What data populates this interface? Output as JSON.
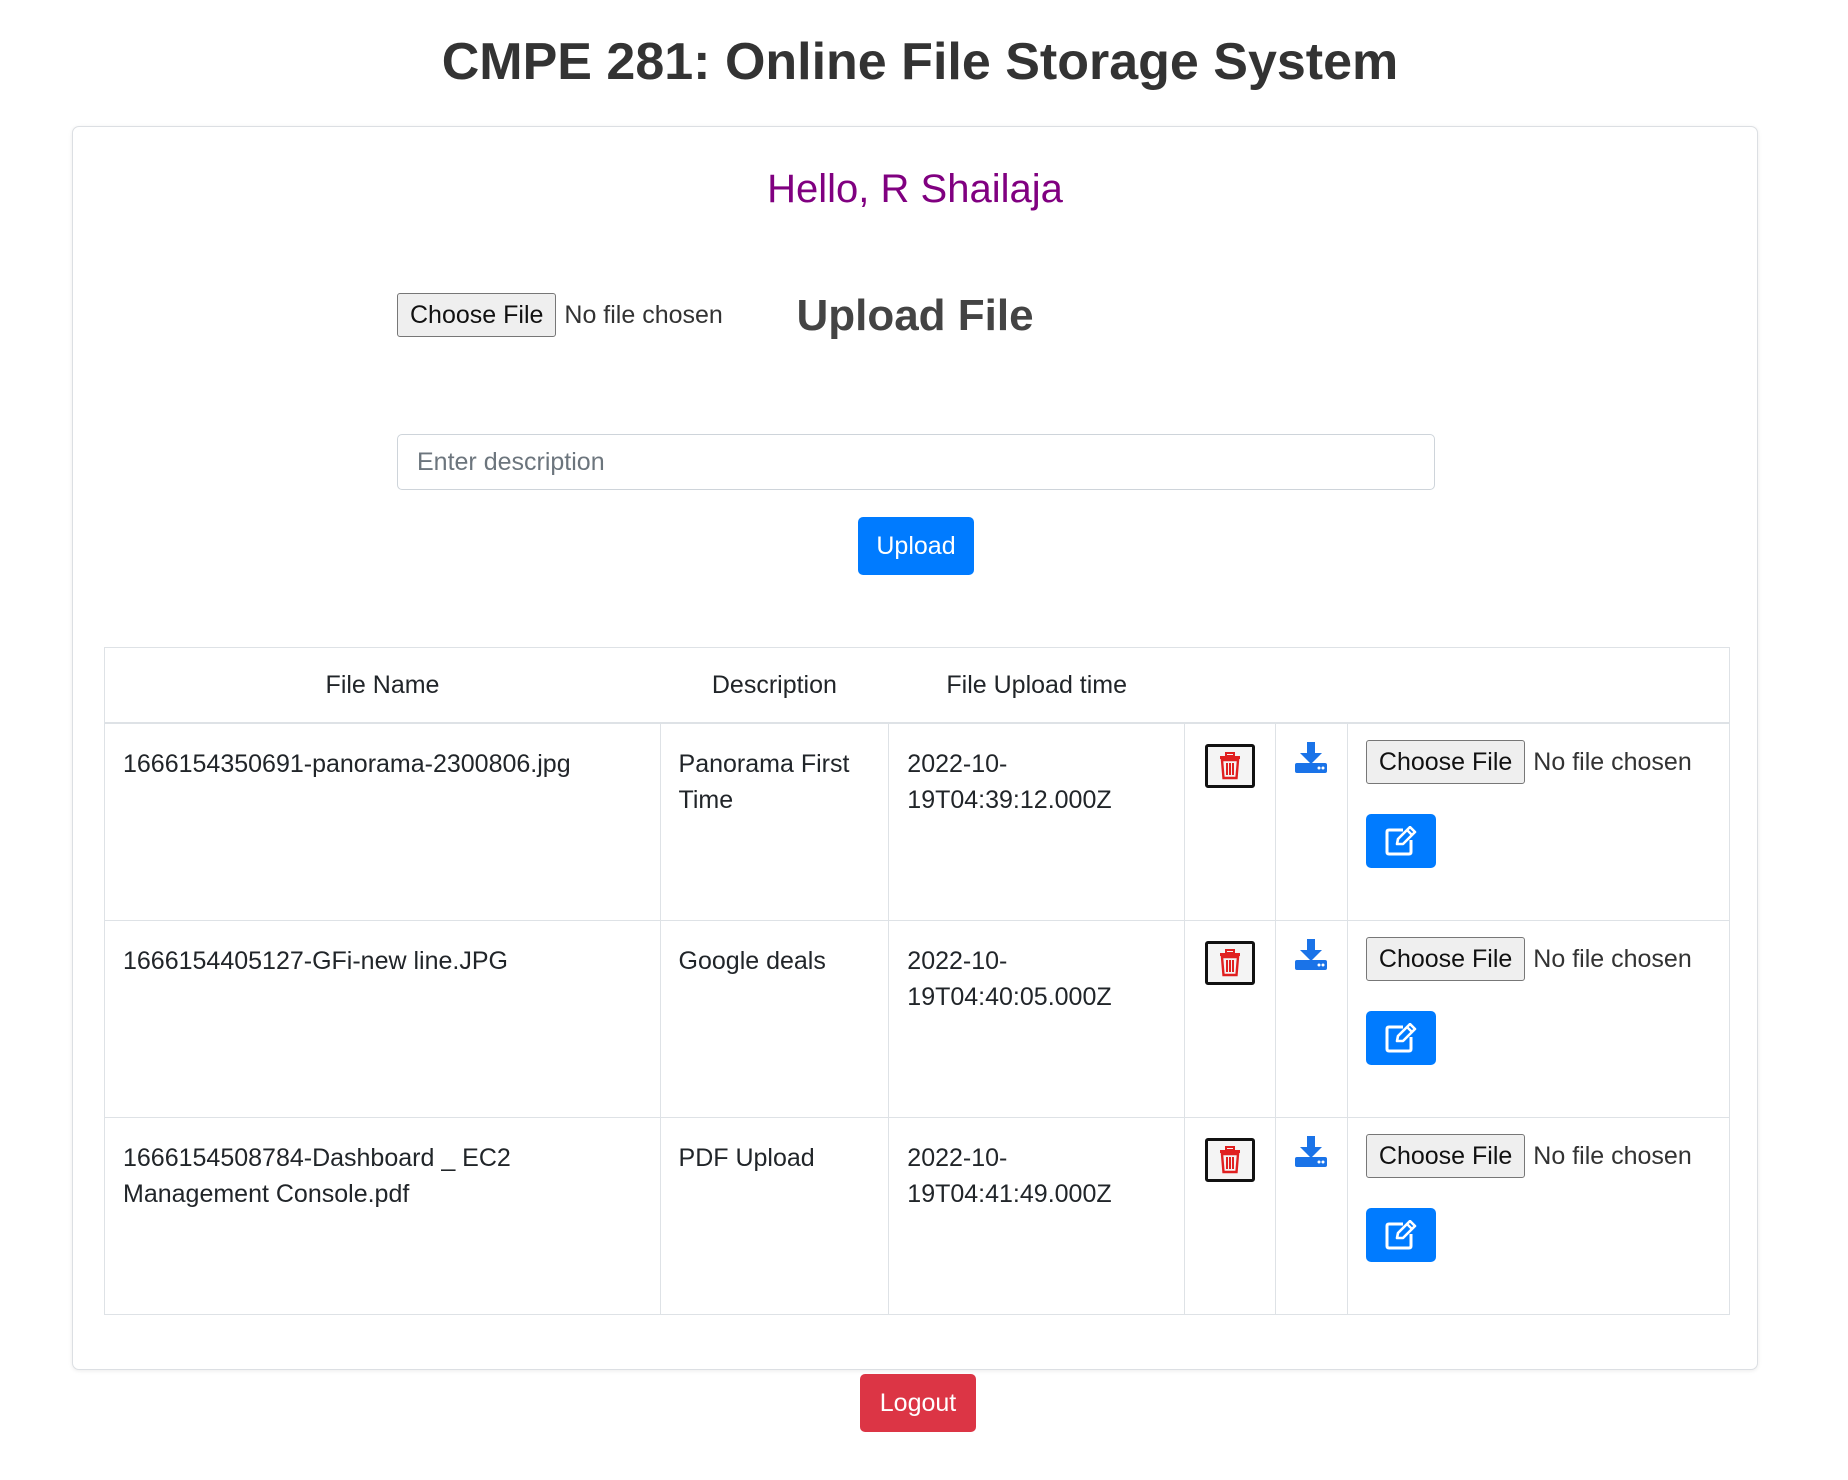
{
  "app": {
    "title": "CMPE 281: Online File Storage System"
  },
  "greeting": "Hello, R Shailaja",
  "upload_section": {
    "heading": "Upload File",
    "choose_label": "Choose File",
    "no_file_text": "No file chosen",
    "description_placeholder": "Enter description",
    "upload_label": "Upload"
  },
  "table": {
    "headers": [
      "File Name",
      "Description",
      "File Upload time",
      "",
      "",
      ""
    ],
    "rows": [
      {
        "file_name": "1666154350691-panorama-2300806.jpg",
        "description": "Panorama First Time",
        "upload_time": "2022-10-19T04:39:12.000Z",
        "choose_label": "Choose File",
        "no_file_text": "No file chosen"
      },
      {
        "file_name": "1666154405127-GFi-new line.JPG",
        "description": "Google deals",
        "upload_time": "2022-10-19T04:40:05.000Z",
        "choose_label": "Choose File",
        "no_file_text": "No file chosen"
      },
      {
        "file_name": "1666154508784-Dashboard _ EC2 Management Console.pdf",
        "description": "PDF Upload",
        "upload_time": "2022-10-19T04:41:49.000Z",
        "choose_label": "Choose File",
        "no_file_text": "No file chosen"
      }
    ]
  },
  "logout_label": "Logout",
  "icons": {
    "delete": "trash-icon",
    "download": "download-icon",
    "edit": "edit-icon"
  },
  "colors": {
    "primary": "#007bff",
    "danger": "#dc3545",
    "greeting": "#800080",
    "trash": "#e02020"
  }
}
